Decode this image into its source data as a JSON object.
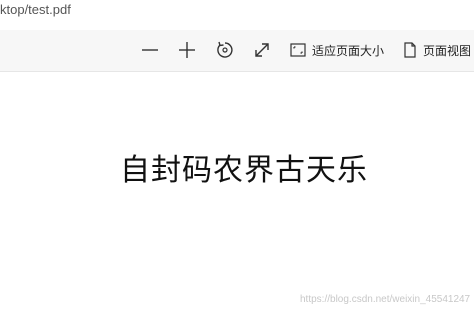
{
  "address_bar": {
    "url": "ktop/test.pdf"
  },
  "toolbar": {
    "zoom_out_icon": "minus-icon",
    "zoom_in_icon": "plus-icon",
    "rotate_icon": "rotate-icon",
    "fullscreen_icon": "expand-icon",
    "fit_page_icon": "fit-page-icon",
    "fit_page_label": "适应页面大小",
    "page_view_icon": "page-icon",
    "page_view_label": "页面视图"
  },
  "document": {
    "text": "自封码农界古天乐"
  },
  "watermark": "https://blog.csdn.net/weixin_45541247"
}
